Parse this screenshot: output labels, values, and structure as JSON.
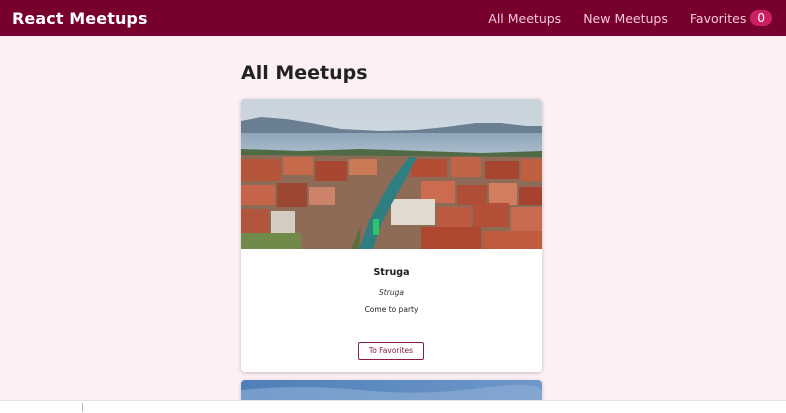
{
  "app": {
    "title": "React Meetups"
  },
  "nav": {
    "all_meetups": "All Meetups",
    "new_meetup": "New Meetups",
    "favorites": "Favorites",
    "favorites_count": "0"
  },
  "main": {
    "heading": "All Meetups",
    "meetups": [
      {
        "title": "Struga",
        "address": "Struga",
        "description": "Come to party",
        "button_label": "To Favorites"
      }
    ]
  },
  "colors": {
    "header_bg": "#77002e",
    "page_bg": "#fcf0f4",
    "badge_bg": "#cc2062",
    "button_border": "#8b1b3f"
  }
}
